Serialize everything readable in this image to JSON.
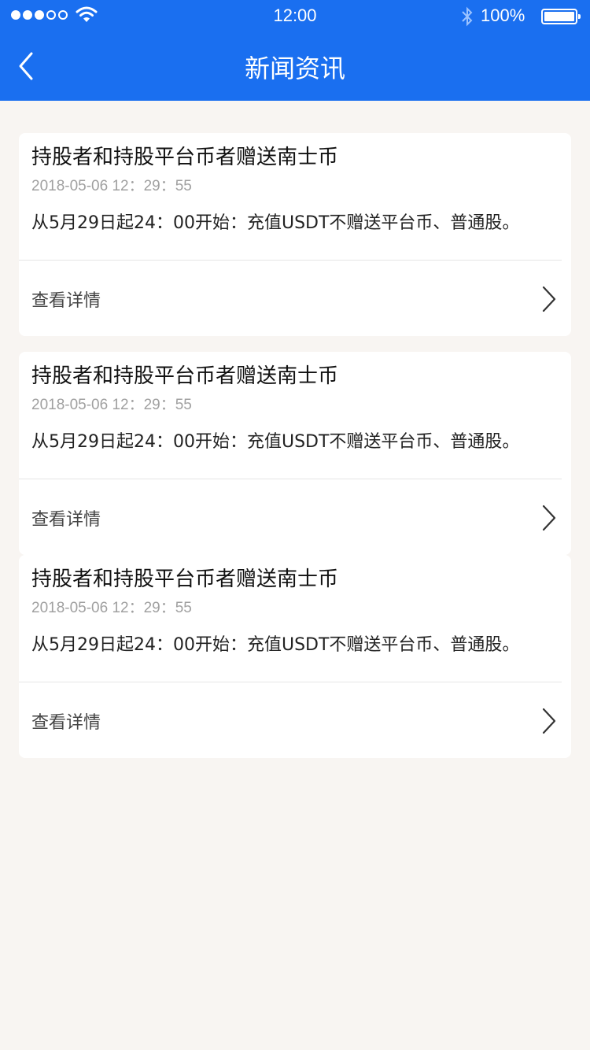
{
  "status_bar": {
    "time": "12:00",
    "battery": "100%",
    "icons": [
      "signal-dots-icon",
      "wifi-icon",
      "bluetooth-icon",
      "battery-icon"
    ]
  },
  "nav": {
    "title": "新闻资讯",
    "back_icon": "chevron-left-icon"
  },
  "colors": {
    "header_bg": "#1a6ff0",
    "page_bg": "#f8f5f2",
    "card_bg": "#ffffff"
  },
  "news": [
    {
      "title": "持股者和持股平台币者赠送南士币",
      "time": "2018-05-06   12：29：55",
      "desc": "从5月29日起24：00开始：充值USDT不赠送平台币、普通股。",
      "detail_label": "查看详情"
    },
    {
      "title": "持股者和持股平台币者赠送南士币",
      "time": "2018-05-06   12：29：55",
      "desc": "从5月29日起24：00开始：充值USDT不赠送平台币、普通股。",
      "detail_label": "查看详情"
    },
    {
      "title": "持股者和持股平台币者赠送南士币",
      "time": "2018-05-06   12：29：55",
      "desc": "从5月29日起24：00开始：充值USDT不赠送平台币、普通股。",
      "detail_label": "查看详情"
    }
  ]
}
